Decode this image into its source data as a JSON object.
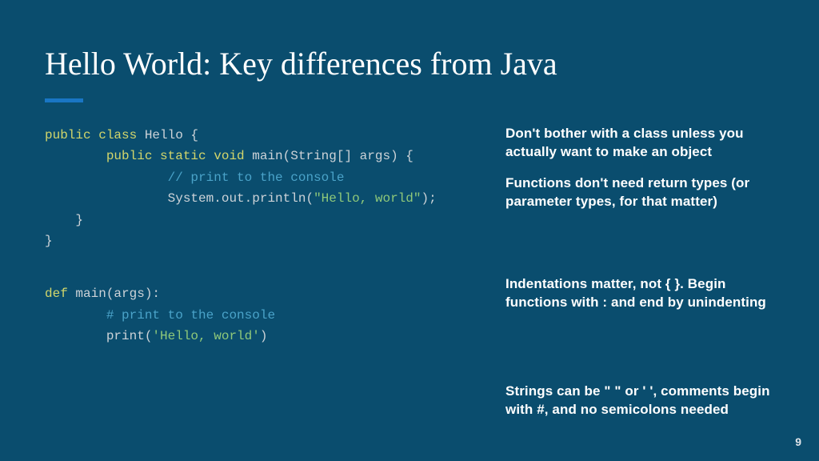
{
  "title": "Hello World: Key differences from Java",
  "pageNumber": "9",
  "javaCode": {
    "line1": {
      "kw": "public class",
      "rest": " Hello {"
    },
    "line2": {
      "indent": "        ",
      "kw": "public static void",
      "rest": " main(String[] args) {"
    },
    "line3": {
      "indent": "                ",
      "comment": "// print to the console"
    },
    "line4": {
      "indent": "                ",
      "pre": "System.out.println(",
      "str": "\"Hello, world\"",
      "post": ");"
    },
    "line5": "    }",
    "line6": "}"
  },
  "pythonCode": {
    "line1": {
      "kw": "def",
      "rest": " main(args):"
    },
    "line2": {
      "indent": "        ",
      "comment": "# print to the console"
    },
    "line3": {
      "indent": "        ",
      "pre": "print(",
      "str": "'Hello, world'",
      "post": ")"
    }
  },
  "notes": {
    "n1": "Don't bother with a class unless you actually want to make an object",
    "n2": "Functions don't need return types (or parameter types, for that matter)",
    "n3": "Indentations matter, not { }. Begin functions with : and end by unindenting",
    "n4": "Strings can be \" \" or ' ', comments begin with #, and no semicolons needed"
  }
}
